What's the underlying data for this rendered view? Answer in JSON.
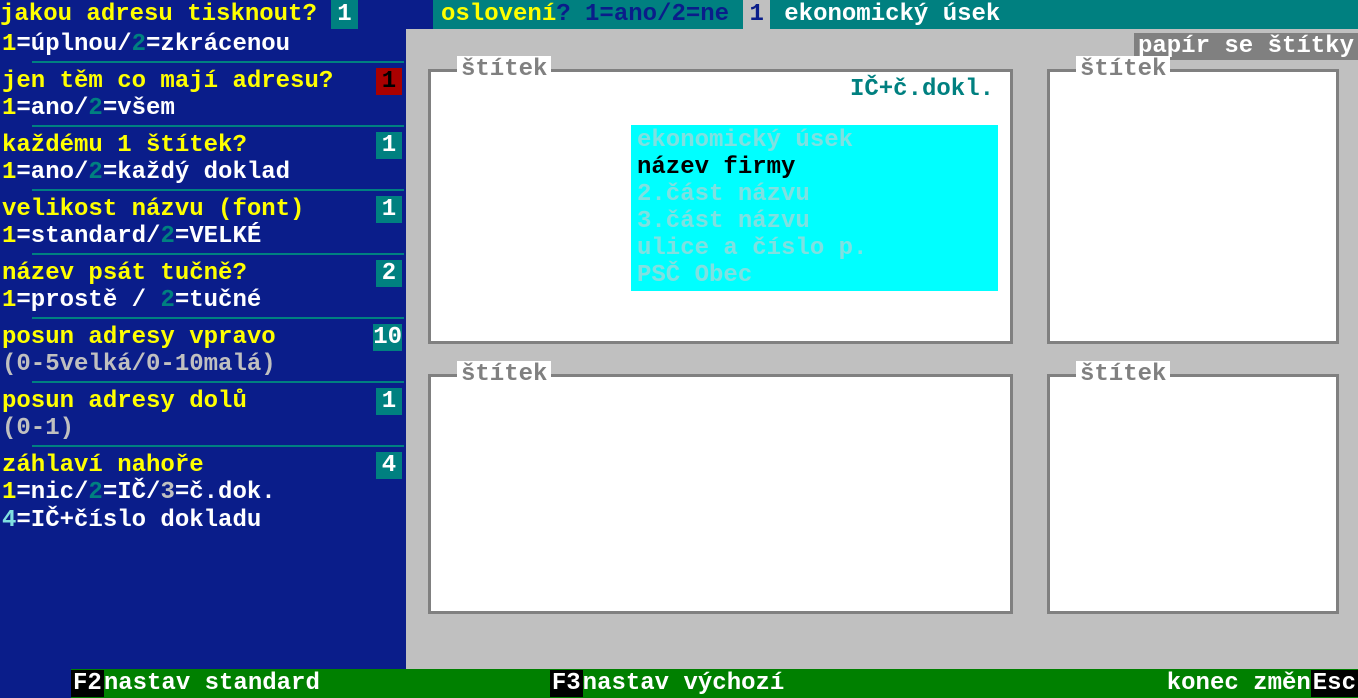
{
  "top": {
    "q1": "jakou adresu tisknout?",
    "q1_val": "1",
    "q2": "oslovení",
    "q2_help": "1=ano/2=ne",
    "q2_val": "1",
    "q2_extra": "ekonomický úsek"
  },
  "options": [
    {
      "label": "",
      "value": "",
      "help_pre": "1",
      "help_mid": "=úplnou/",
      "help_n2": "2",
      "help_post": "=zkrácenou",
      "sep": true
    },
    {
      "label": "jen těm co mají adresu?",
      "value": "1",
      "valred": true,
      "help_pre": "1",
      "help_mid": "=ano/",
      "help_n2": "2",
      "help_post": "=všem",
      "sep": true
    },
    {
      "label": "každému 1 štítek?",
      "value": "1",
      "help_pre": "1",
      "help_mid": "=ano/",
      "help_n2": "2",
      "help_post": "=každý doklad",
      "sep": true
    },
    {
      "label": "velikost názvu (font)",
      "value": "1",
      "help_pre": "1",
      "help_mid": "=standard/",
      "help_n2": "2",
      "help_post": "=VELKÉ",
      "sep": true
    },
    {
      "label": "název psát tučně?",
      "value": "2",
      "help_pre": "1",
      "help_mid": "=prostě / ",
      "help_n2": "2",
      "help_post": "=tučné",
      "sep": true
    },
    {
      "label": "posun adresy vpravo",
      "value": "10",
      "help_gray": "(0-5velká/0-10malá)",
      "sep": true
    },
    {
      "label": "posun adresy dolů",
      "value": "1",
      "help_gray": "(0-1)",
      "sep": true
    },
    {
      "label": "záhlaví nahoře",
      "value": "4",
      "help_complex": true,
      "sep": false
    }
  ],
  "zahlavi_help": {
    "l1_1": "1",
    "l1_t1": "=nic/",
    "l1_2": "2",
    "l1_t2": "=IČ/",
    "l1_3": "3",
    "l1_t3": "=č.dok.",
    "l2_4": "4",
    "l2_t": "=IČ+číslo dokladu"
  },
  "paper_label": "papír se štítky",
  "stitek_title": "štítek",
  "label_header": "IČ+č.dokl.",
  "cyan": {
    "l1": "ekonomický úsek",
    "l2": "název firmy",
    "l3": "2.část názvu",
    "l4": "3.část názvu",
    "l5": "ulice a číslo p.",
    "l6": "PSČ  Obec"
  },
  "bottom": {
    "f2": "F2",
    "f2t": "nastav standard",
    "f3": "F3",
    "f3t": "nastav výchozí",
    "endt": "konec změn",
    "esc": "Esc"
  }
}
